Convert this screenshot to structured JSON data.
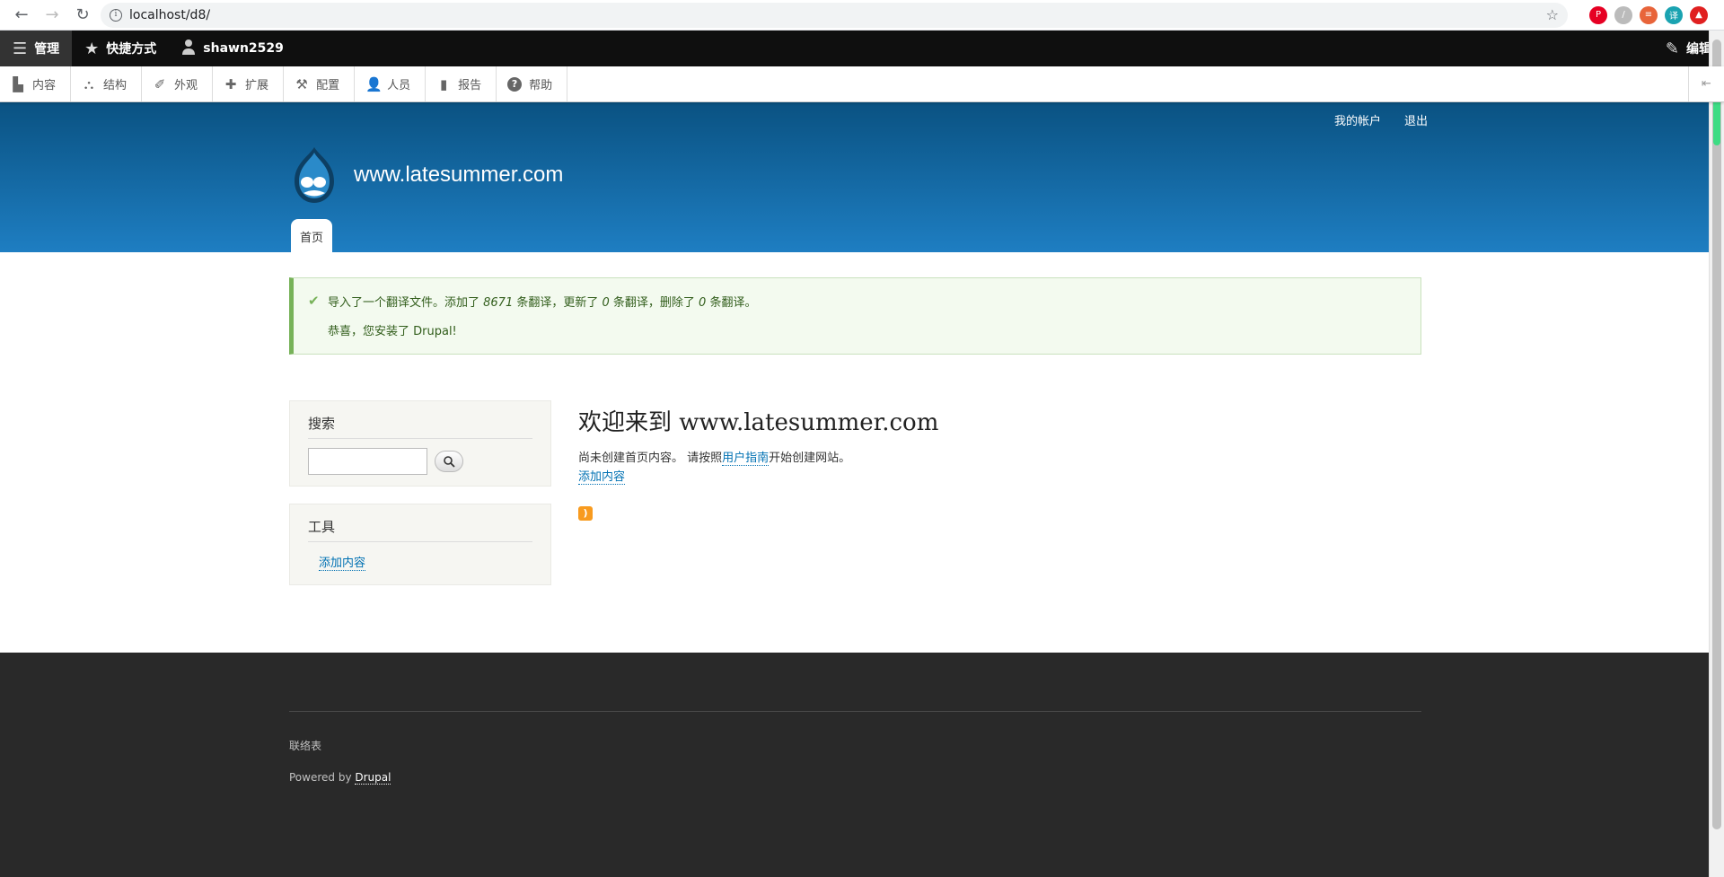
{
  "browser": {
    "url": "localhost/d8/",
    "extensions": [
      {
        "name": "pinterest-icon",
        "color": "#e60023",
        "glyph": "P"
      },
      {
        "name": "extension-icon",
        "color": "#bbbbbb",
        "glyph": "/"
      },
      {
        "name": "settings-icon",
        "color": "#e8643a",
        "glyph": "≡"
      },
      {
        "name": "translate-icon",
        "color": "#1aa3b1",
        "glyph": "译"
      },
      {
        "name": "upload-icon",
        "color": "#e02020",
        "glyph": "▲"
      }
    ]
  },
  "toolbar": {
    "manage": "管理",
    "shortcuts": "快捷方式",
    "user": "shawn2529",
    "edit": "编辑"
  },
  "tray": [
    {
      "label": "内容",
      "icon": "content-icon"
    },
    {
      "label": "结构",
      "icon": "structure-icon"
    },
    {
      "label": "外观",
      "icon": "appearance-icon"
    },
    {
      "label": "扩展",
      "icon": "extend-icon"
    },
    {
      "label": "配置",
      "icon": "config-icon"
    },
    {
      "label": "人员",
      "icon": "people-icon"
    },
    {
      "label": "报告",
      "icon": "reports-icon"
    },
    {
      "label": "帮助",
      "icon": "help-icon"
    }
  ],
  "header": {
    "my_account": "我的帐户",
    "logout": "退出",
    "site_name": "www.latesummer.com",
    "home_tab": "首页"
  },
  "message": {
    "part1": "导入了一个翻译文件。添加了 ",
    "added": "8671",
    "part2": " 条翻译，更新了 ",
    "updated": "0",
    "part3": " 条翻译，删除了 ",
    "deleted": "0",
    "part4": " 条翻译。",
    "line2": "恭喜，您安装了 Drupal!"
  },
  "sidebar": {
    "search_title": "搜索",
    "tools_title": "工具",
    "tools_link": "添加内容"
  },
  "main": {
    "title": "欢迎来到 www.latesummer.com",
    "text_before": "尚未创建首页内容。 请按照",
    "guide_link": "用户指南",
    "text_after": "开始创建网站。",
    "add_link": "添加内容"
  },
  "footer": {
    "contact": "联络表",
    "powered_by": "Powered by ",
    "drupal_link": "Drupal"
  }
}
